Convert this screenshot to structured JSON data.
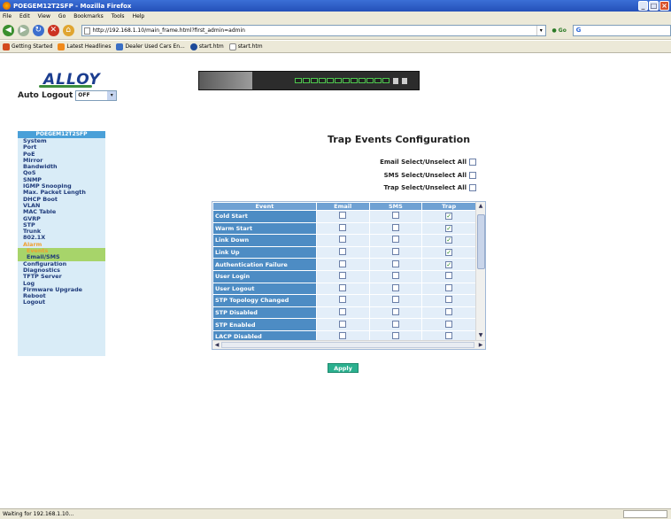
{
  "browser": {
    "window_title": "POEGEM12T2SFP - Mozilla Firefox",
    "menu": [
      "File",
      "Edit",
      "View",
      "Go",
      "Bookmarks",
      "Tools",
      "Help"
    ],
    "url": "http://192.168.1.10/main_frame.html?first_admin=admin",
    "bookmarks": [
      "Getting Started",
      "Latest Headlines",
      "Dealer Used Cars En...",
      "start.htm",
      "start.htm"
    ],
    "status_text": "Waiting for 192.168.1.10..."
  },
  "header": {
    "logo": "ALLOY",
    "auto_logout_label": "Auto Logout",
    "auto_logout_value": "OFF"
  },
  "sidebar": {
    "title": "POEGEM12T2SFP",
    "items": [
      "System",
      "Port",
      "PoE",
      "Mirror",
      "Bandwidth",
      "QoS",
      "SNMP",
      "IGMP Snooping",
      "Max. Packet Length",
      "DHCP Boot",
      "VLAN",
      "MAC Table",
      "GVRP",
      "STP",
      "Trunk",
      "802.1X",
      "Alarm"
    ],
    "sub_items": [
      "Events",
      "Email/SMS"
    ],
    "items_after": [
      "Configuration",
      "Diagnostics",
      "TFTP Server",
      "Log",
      "Firmware Upgrade",
      "Reboot",
      "Logout"
    ]
  },
  "main": {
    "title": "Trap Events Configuration",
    "select_all": {
      "email": "Email Select/Unselect All",
      "sms": "SMS Select/Unselect All",
      "trap": "Trap Select/Unselect All"
    },
    "columns": [
      "Event",
      "Email",
      "SMS",
      "Trap"
    ],
    "rows": [
      {
        "event": "Cold Start",
        "email": false,
        "sms": false,
        "trap": true
      },
      {
        "event": "Warm Start",
        "email": false,
        "sms": false,
        "trap": true
      },
      {
        "event": "Link Down",
        "email": false,
        "sms": false,
        "trap": true
      },
      {
        "event": "Link Up",
        "email": false,
        "sms": false,
        "trap": true
      },
      {
        "event": "Authentication Failure",
        "email": false,
        "sms": false,
        "trap": true
      },
      {
        "event": "User Login",
        "email": false,
        "sms": false,
        "trap": false
      },
      {
        "event": "User Logout",
        "email": false,
        "sms": false,
        "trap": false
      },
      {
        "event": "STP Topology Changed",
        "email": false,
        "sms": false,
        "trap": false
      },
      {
        "event": "STP Disabled",
        "email": false,
        "sms": false,
        "trap": false
      },
      {
        "event": "STP Enabled",
        "email": false,
        "sms": false,
        "trap": false
      },
      {
        "event": "LACP Disabled",
        "email": false,
        "sms": false,
        "trap": false
      }
    ],
    "apply_label": "Apply"
  }
}
